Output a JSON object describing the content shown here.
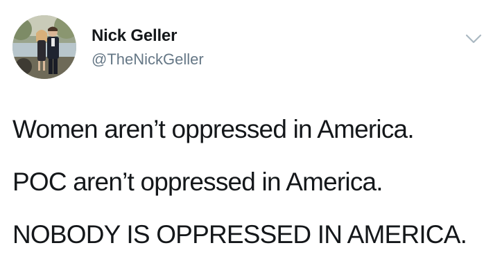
{
  "author": {
    "name": "Nick Geller",
    "handle": "@TheNickGeller"
  },
  "icons": {
    "avatar": "profile-photo",
    "menu": "chevron-down-icon"
  },
  "tweet": {
    "lines": [
      "Women aren’t oppressed in America.",
      "POC aren’t oppressed in America.",
      "NOBODY IS OPPRESSED IN AMERICA."
    ]
  },
  "colors": {
    "text": "#14171a",
    "secondary": "#657786",
    "caret": "#aab8c2",
    "background": "#ffffff"
  }
}
